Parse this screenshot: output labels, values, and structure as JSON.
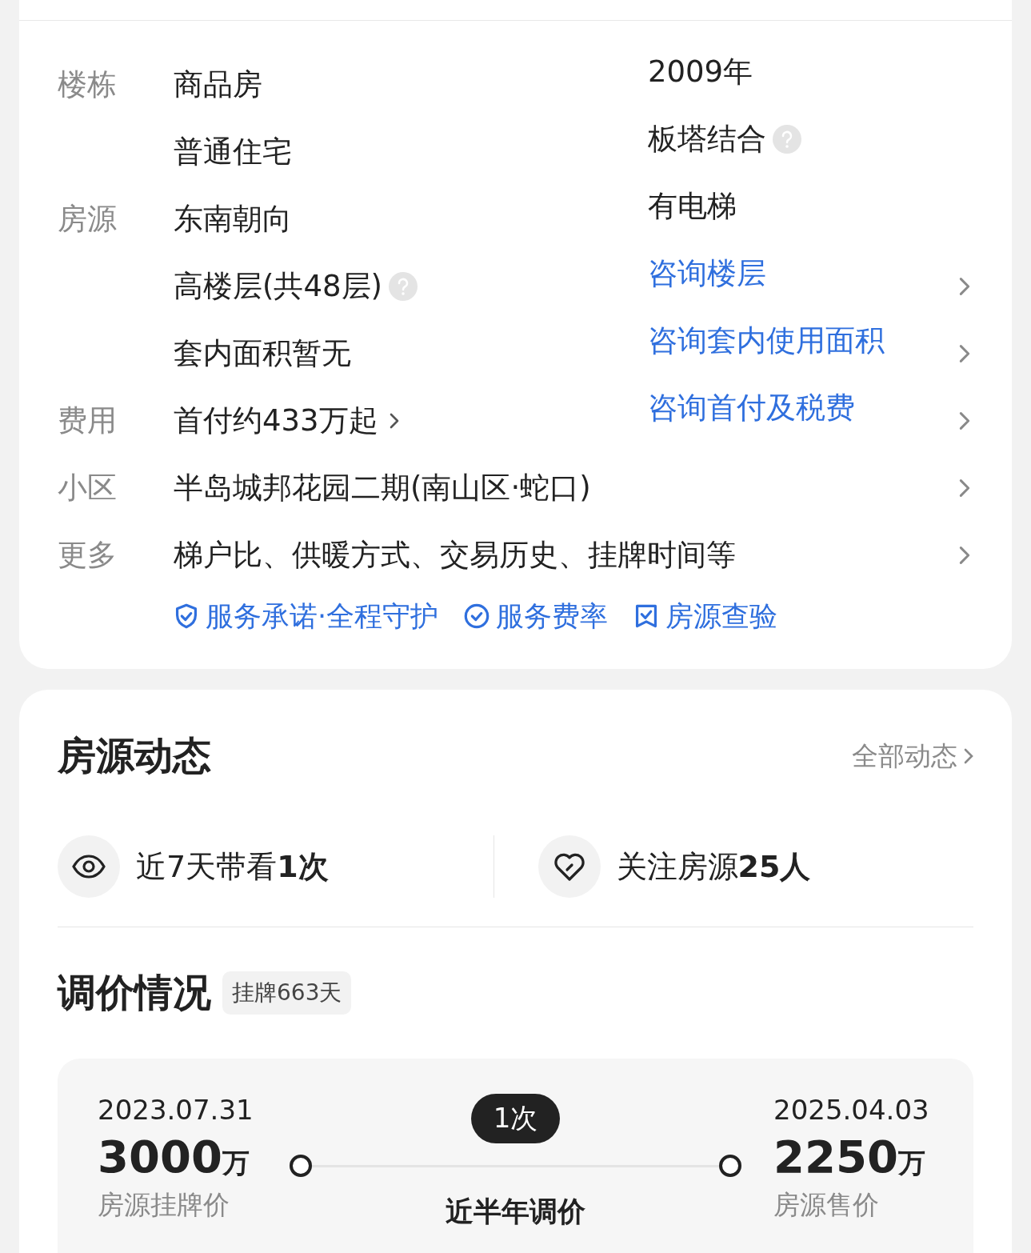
{
  "info": {
    "rows": [
      {
        "label": "楼栋",
        "cells": [
          {
            "text": "商品房",
            "kind": "plain",
            "help": false,
            "arrow": false
          },
          {
            "text": "2009年",
            "kind": "plain",
            "help": false,
            "arrow": false
          }
        ],
        "chevron": false
      },
      {
        "cells": [
          {
            "text": "普通住宅",
            "kind": "plain",
            "help": false,
            "arrow": false
          },
          {
            "text": "板塔结合",
            "kind": "plain",
            "help": true,
            "arrow": false
          }
        ],
        "chevron": false
      },
      {
        "label": "房源",
        "cells": [
          {
            "text": "东南朝向",
            "kind": "plain",
            "help": false,
            "arrow": false
          },
          {
            "text": "有电梯",
            "kind": "plain",
            "help": false,
            "arrow": false
          }
        ],
        "chevron": false
      },
      {
        "cells": [
          {
            "text": "高楼层(共48层)",
            "kind": "plain",
            "help": true,
            "arrow": false
          },
          {
            "text": "咨询楼层",
            "kind": "link",
            "help": false,
            "arrow": false
          }
        ],
        "chevron": true
      },
      {
        "cells": [
          {
            "text": "套内面积暂无",
            "kind": "plain",
            "help": false,
            "arrow": false
          },
          {
            "text": "咨询套内使用面积",
            "kind": "link",
            "help": false,
            "arrow": false
          }
        ],
        "chevron": true
      },
      {
        "label": "费用",
        "cells": [
          {
            "text": "首付约433万起",
            "kind": "plain",
            "help": false,
            "arrow": true
          },
          {
            "text": "咨询首付及税费",
            "kind": "link",
            "help": false,
            "arrow": false
          }
        ],
        "chevron": true
      },
      {
        "label": "小区",
        "cells": [
          {
            "text": "半岛城邦花园二期(南山区·蛇口)",
            "kind": "wide",
            "help": false,
            "arrow": false
          }
        ],
        "chevron": true
      },
      {
        "label": "更多",
        "cells": [
          {
            "text": "梯户比、供暖方式、交易历史、挂牌时间等",
            "kind": "wide",
            "help": false,
            "arrow": false
          }
        ],
        "chevron": true
      }
    ],
    "services": [
      "服务承诺·全程守护",
      "服务费率",
      "房源查验"
    ]
  },
  "dynamics": {
    "title": "房源动态",
    "link": "全部动态",
    "stats": [
      "近7天带看**1次**",
      "关注房源**25人**"
    ],
    "price": {
      "title": "调价情况",
      "badge": "挂牌663天",
      "start": {
        "date": "2023.07.31",
        "amount": "3000",
        "unit": "万",
        "label": "房源挂牌价"
      },
      "count": "1次",
      "caption": "近半年调价",
      "end": {
        "date": "2025.04.03",
        "amount": "2250",
        "unit": "万",
        "label": "房源售价"
      }
    }
  }
}
